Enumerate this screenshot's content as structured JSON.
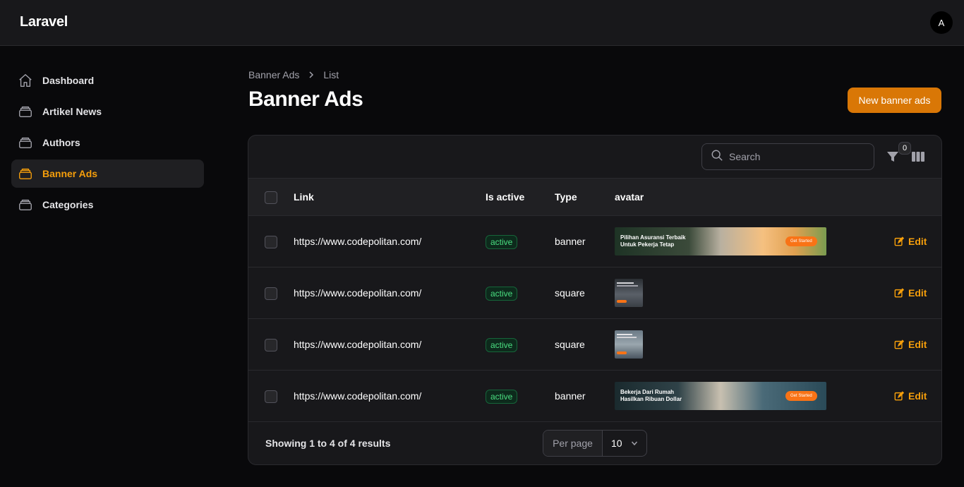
{
  "app": {
    "brand": "Laravel",
    "user_initial": "A"
  },
  "sidebar": {
    "items": [
      {
        "label": "Dashboard",
        "icon": "home-icon"
      },
      {
        "label": "Artikel News",
        "icon": "stack-icon"
      },
      {
        "label": "Authors",
        "icon": "stack-icon"
      },
      {
        "label": "Banner Ads",
        "icon": "stack-icon"
      },
      {
        "label": "Categories",
        "icon": "stack-icon"
      }
    ]
  },
  "breadcrumb": {
    "parent": "Banner Ads",
    "current": "List"
  },
  "page": {
    "title": "Banner Ads",
    "new_button": "New banner ads"
  },
  "table": {
    "search_placeholder": "Search",
    "filter_count": "0",
    "columns": {
      "link": "Link",
      "is_active": "Is active",
      "type": "Type",
      "avatar": "avatar"
    },
    "rows": [
      {
        "link": "https://www.codepolitan.com/",
        "status": "active",
        "type": "banner",
        "banner_text_1": "Pilihan Asuransi Terbaik",
        "banner_text_2": "Untuk Pekerja Tetap",
        "banner_cta": "Get Started",
        "edit": "Edit"
      },
      {
        "link": "https://www.codepolitan.com/",
        "status": "active",
        "type": "square",
        "edit": "Edit"
      },
      {
        "link": "https://www.codepolitan.com/",
        "status": "active",
        "type": "square",
        "edit": "Edit"
      },
      {
        "link": "https://www.codepolitan.com/",
        "status": "active",
        "type": "banner",
        "banner_text_1": "Bekerja Dari Rumah",
        "banner_text_2": "Hasilkan Ribuan Dollar",
        "banner_cta": "Get Started",
        "edit": "Edit"
      }
    ],
    "results_text": "Showing 1 to 4 of 4 results",
    "per_page_label": "Per page",
    "per_page_value": "10"
  },
  "colors": {
    "accent": "#f59e0b",
    "button": "#d97706",
    "success": "#4ade80",
    "background": "#09090b"
  }
}
